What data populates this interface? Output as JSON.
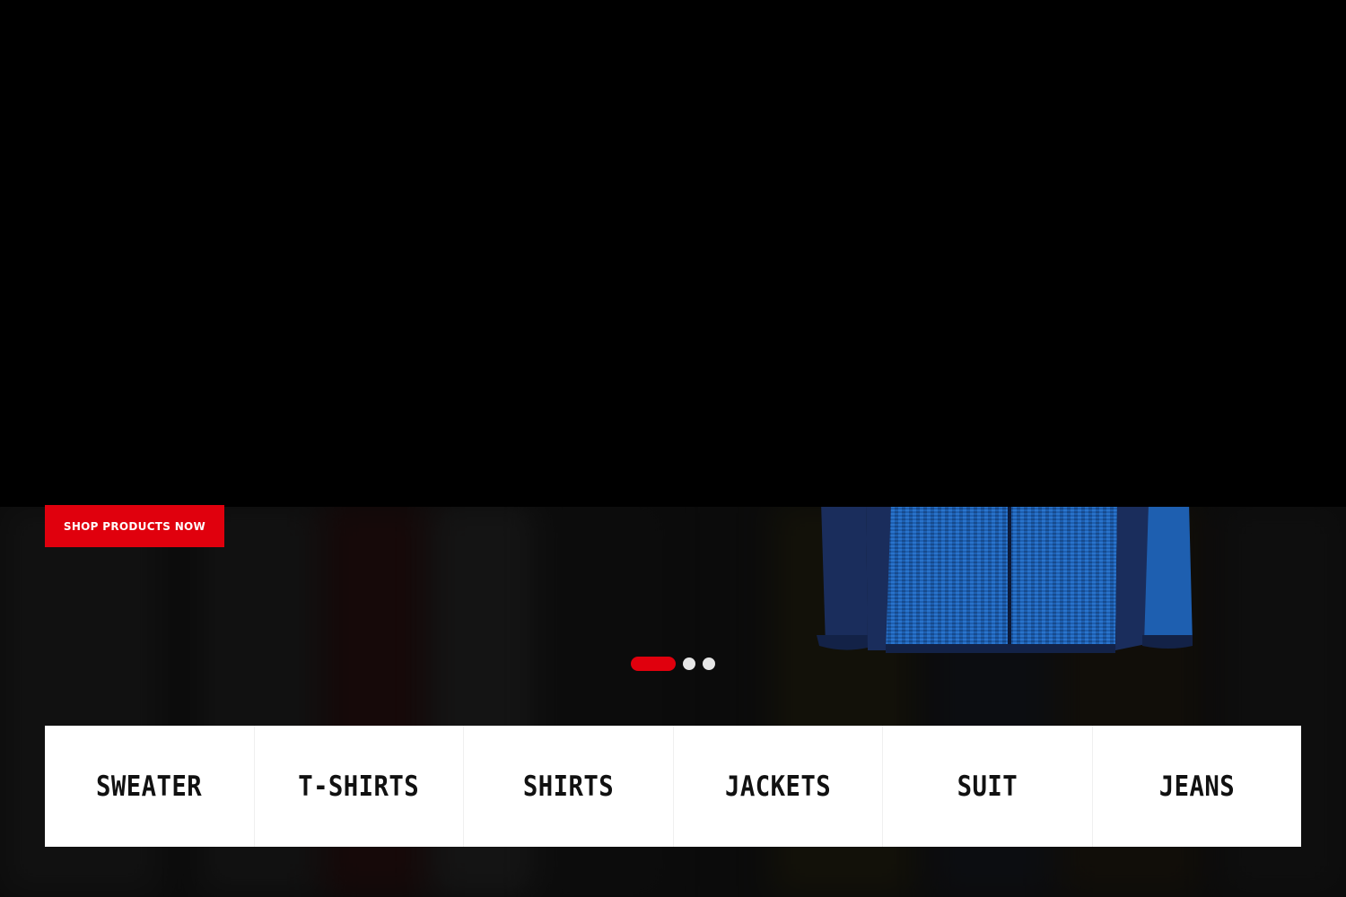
{
  "hero": {
    "cta_label": "SHOP PRODUCTS NOW",
    "accent_color": "#e0000d",
    "product_image": "blue-knit-jacket",
    "slider": {
      "total_slides": 3,
      "active_slide": 1
    }
  },
  "categories": [
    {
      "label": "SWEATER"
    },
    {
      "label": "T-SHIRTS"
    },
    {
      "label": "SHIRTS"
    },
    {
      "label": "JACKETS"
    },
    {
      "label": "SUIT"
    },
    {
      "label": "JEANS"
    }
  ]
}
